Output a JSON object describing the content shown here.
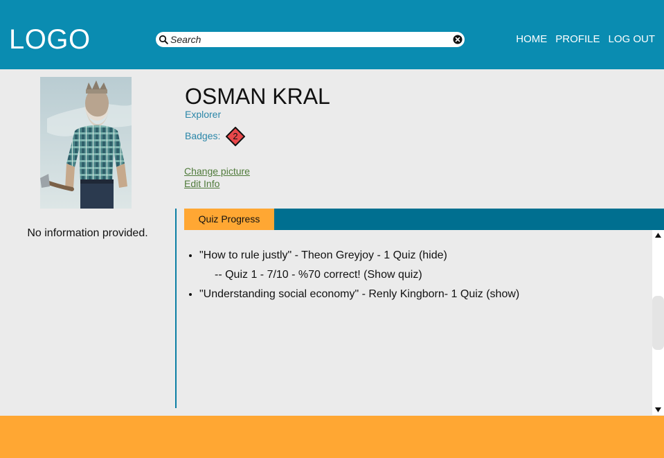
{
  "header": {
    "logo": "LOGO",
    "search": {
      "placeholder": "Search",
      "value": ""
    },
    "nav": [
      "HOME",
      "PROFILE",
      "LOG OUT"
    ]
  },
  "profile": {
    "name": "OSMAN KRAL",
    "role": "Explorer",
    "badges_label": "Badges:",
    "badge_count": "2",
    "change_picture": "Change picture",
    "edit_info": "Edit Info",
    "about": "No information provided."
  },
  "tabs": [
    "Quiz Progress"
  ],
  "quiz_progress": {
    "items": [
      "\"How to rule justly\" - Theon Greyjoy - 1 Quiz (hide)",
      "\"Understanding social economy\" - Renly Kingborn- 1 Quiz (show)"
    ],
    "sub_item": "-- Quiz 1 - 7/10 - %70 correct! (Show quiz)"
  },
  "colors": {
    "header": "#0a8cb1",
    "tab_bar": "#006f90",
    "accent": "#ffa733",
    "badge": "#e8474a",
    "link": "#2a86a8",
    "link_green": "#4f7a3a"
  },
  "icons": {
    "search": "search-icon",
    "clear": "close-circle-icon",
    "badge": "diamond-badge-icon"
  }
}
